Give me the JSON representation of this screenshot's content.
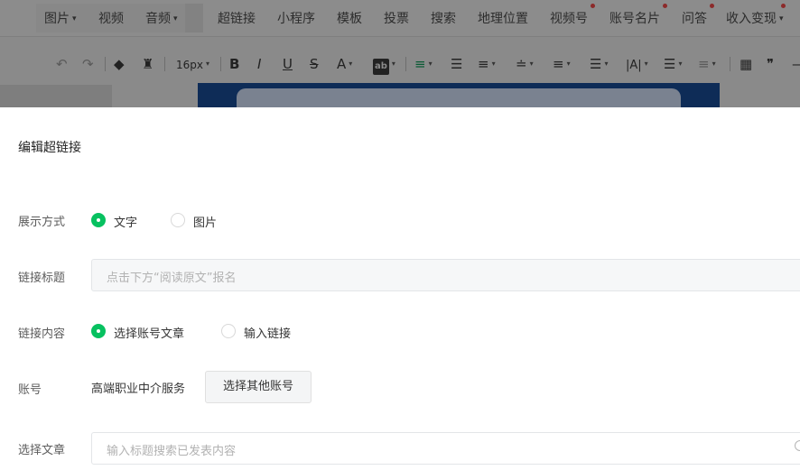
{
  "menubar": {
    "items": [
      {
        "label": "图片",
        "caret": "▾"
      },
      {
        "label": "视频"
      },
      {
        "label": "音频",
        "caret": "▾"
      },
      {
        "label": "超链接"
      },
      {
        "label": "小程序"
      },
      {
        "label": "模板"
      },
      {
        "label": "投票"
      },
      {
        "label": "搜索"
      },
      {
        "label": "地理位置"
      },
      {
        "label": "视频号"
      },
      {
        "label": "账号名片"
      },
      {
        "label": "问答"
      },
      {
        "label": "收入变现",
        "caret": "▾"
      }
    ]
  },
  "toolbar": {
    "undo": "↶",
    "redo": "↷",
    "paint": "◆",
    "clear": "♜",
    "font_size": "16px",
    "bold": "B",
    "italic": "I",
    "underline": "U",
    "strike": "S",
    "font_color": "A",
    "bg_color": "ab",
    "align_center": "≡",
    "indent": "☰",
    "justify": "≡",
    "line_height": "≐",
    "para_space": "≡",
    "letter_space": "|A|",
    "list": "☰",
    "table": "▦",
    "quote": "❞",
    "hr": "—",
    "caret": "▾"
  },
  "dialog": {
    "title": "编辑超链接",
    "display_mode": {
      "label": "展示方式",
      "options": [
        "文字",
        "图片"
      ],
      "selected": "文字"
    },
    "link_title": {
      "label": "链接标题",
      "placeholder": "点击下方“阅读原文”报名"
    },
    "link_content": {
      "label": "链接内容",
      "options": [
        "选择账号文章",
        "输入链接"
      ],
      "selected": "选择账号文章"
    },
    "account": {
      "label": "账号",
      "name": "高端职业中介服务",
      "button": "选择其他账号"
    },
    "article": {
      "label": "选择文章",
      "placeholder": "输入标题搜索已发表内容"
    }
  }
}
